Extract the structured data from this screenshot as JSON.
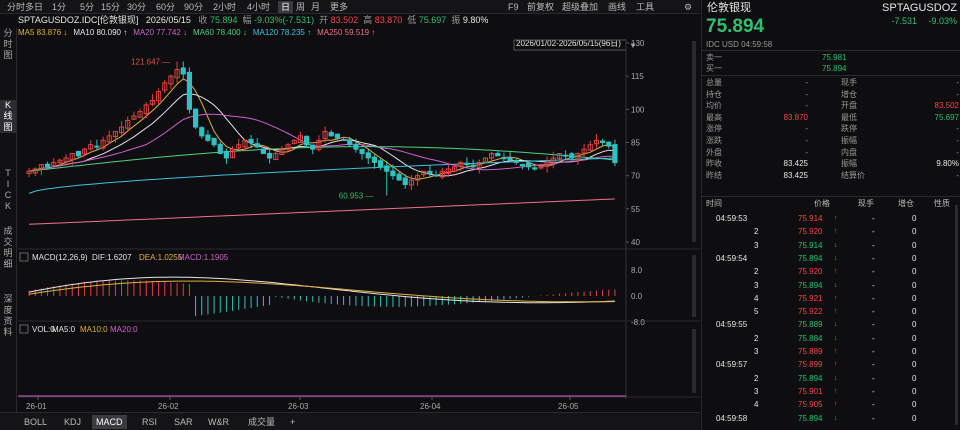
{
  "toolbar": {
    "timeframes": [
      "分时",
      "多日",
      "1分",
      "5分",
      "15分",
      "30分",
      "60分",
      "90分",
      "2小时",
      "4小时",
      "日",
      "周",
      "月",
      "更多"
    ],
    "active": "日",
    "tools": [
      "F9",
      "前复权",
      "超级叠加",
      "画线",
      "工具"
    ],
    "settings_icon": "gear-icon"
  },
  "left_tabs": [
    "分时图",
    "K线图",
    "TICK",
    "成交明细",
    "深度资料"
  ],
  "left_tabs_active": 1,
  "info": {
    "symbol": "SPTAGUSDOZ.IDC[伦敦银现]",
    "date": "2026/05/15",
    "close_label": "收",
    "close": "75.894",
    "change_label": "幅",
    "change": "-9.03%(-7.531)",
    "open_label": "开",
    "open": "83.502",
    "high_label": "高",
    "high": "83.870",
    "low_label": "低",
    "low": "75.697",
    "amp_label": "振",
    "amp": "9.80%"
  },
  "ma": [
    {
      "text": "MA5 83.876 ↓",
      "color": "#e0b040"
    },
    {
      "text": "MA10 80.090 ↑",
      "color": "#e6e6e6"
    },
    {
      "text": "MA20 77.742 ↓",
      "color": "#d060d0"
    },
    {
      "text": "MA60 78.400 ↓",
      "color": "#50d080"
    },
    {
      "text": "MA120 78.235 ↑",
      "color": "#40c0e0"
    },
    {
      "text": "MA250 59.519 ↑",
      "color": "#f07090"
    }
  ],
  "date_range": "2026/01/02-2026/05/15(96日)",
  "chart_data": {
    "type": "candlestick",
    "y_ticks": [
      "130",
      "115",
      "100",
      "85",
      "70",
      "55",
      "40"
    ],
    "y_range": [
      40,
      130
    ],
    "x_ticks": [
      "26-01",
      "26-02",
      "26-03",
      "26-04",
      "26-05"
    ],
    "annotations": {
      "high": "121.647",
      "low": "60.953"
    },
    "macd": {
      "label": "MACD(12,26,9)",
      "dif": "DIF:1.6207",
      "dea": "DEA:1.0255",
      "macd": "MACD:1.1905",
      "ticks": [
        "8.0",
        "0.0",
        "-8.0"
      ]
    },
    "vol": {
      "label": "VOL:0",
      "ma5": "MA5:0",
      "ma10": "MA10:0",
      "ma20": "MA20:0"
    }
  },
  "bottom_tabs": [
    "BOLL",
    "KDJ",
    "MACD",
    "RSI",
    "SAR",
    "W&R",
    "成交量",
    "+"
  ],
  "bottom_active": "MACD",
  "quote": {
    "name": "伦敦银现",
    "code": "SPTAGUSDOZ",
    "price": "75.894",
    "change": "-7.531",
    "pct": "-9.03%",
    "meta": "IDC USD 04:59:58",
    "ask_label": "卖一",
    "ask": "75.981",
    "bid_label": "买一",
    "bid": "75.894",
    "fields": [
      [
        "总量",
        "-",
        "现手",
        "-"
      ],
      [
        "持仓",
        "-",
        "增仓",
        "-"
      ],
      [
        "均价",
        "-",
        "开盘",
        "83.502"
      ],
      [
        "最高",
        "83.870",
        "最低",
        "75.697"
      ],
      [
        "涨停",
        "-",
        "跌停",
        "-"
      ],
      [
        "涨跌",
        "-",
        "振幅",
        "-"
      ],
      [
        "外盘",
        "-",
        "内盘",
        "-"
      ],
      [
        "昨收",
        "83.425",
        "振幅",
        "9.80%"
      ],
      [
        "昨结",
        "83.425",
        "结算价",
        "-"
      ]
    ],
    "tick_headers": [
      "时间",
      "价格",
      "现手",
      "增仓",
      "性质"
    ],
    "ticks": [
      [
        "04:59:53",
        "75.914",
        "up"
      ],
      [
        "2",
        "75.920",
        "up"
      ],
      [
        "3",
        "75.914",
        "down"
      ],
      [
        "04:59:54",
        "75.894",
        "down"
      ],
      [
        "2",
        "75.920",
        "up"
      ],
      [
        "3",
        "75.894",
        "down"
      ],
      [
        "4",
        "75.921",
        "up"
      ],
      [
        "5",
        "75.922",
        "up"
      ],
      [
        "04:59:55",
        "75.889",
        "down"
      ],
      [
        "2",
        "75.884",
        "down"
      ],
      [
        "3",
        "75.889",
        "up"
      ],
      [
        "04:59:57",
        "75.899",
        "up"
      ],
      [
        "2",
        "75.894",
        "down"
      ],
      [
        "3",
        "75.901",
        "up"
      ],
      [
        "4",
        "75.905",
        "up"
      ],
      [
        "04:59:58",
        "75.894",
        "down"
      ]
    ]
  }
}
